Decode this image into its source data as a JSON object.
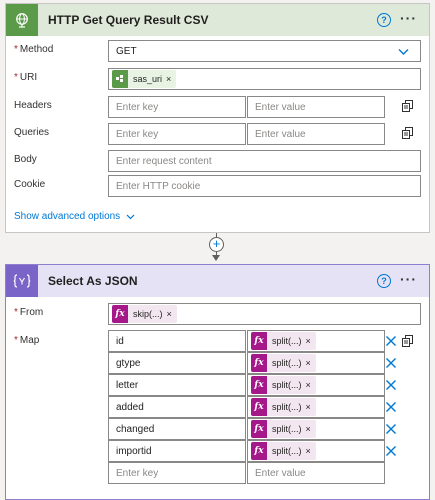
{
  "card1": {
    "title": "HTTP Get Query Result CSV",
    "help": "?",
    "more": "···",
    "method": {
      "label": "Method",
      "value": "GET"
    },
    "uri": {
      "label": "URI",
      "token": "sas_uri"
    },
    "headers": {
      "label": "Headers",
      "key_placeholder": "Enter key",
      "value_placeholder": "Enter value"
    },
    "queries": {
      "label": "Queries",
      "key_placeholder": "Enter key",
      "value_placeholder": "Enter value"
    },
    "body": {
      "label": "Body",
      "placeholder": "Enter request content"
    },
    "cookie": {
      "label": "Cookie",
      "placeholder": "Enter HTTP cookie"
    },
    "advanced": "Show advanced options"
  },
  "add_step": "+",
  "card2": {
    "title": "Select As JSON",
    "help": "?",
    "more": "···",
    "from": {
      "label": "From",
      "token": "skip(...)"
    },
    "map": {
      "label": "Map",
      "rows": [
        {
          "key": "id",
          "token": "split(...)"
        },
        {
          "key": "gtype",
          "token": "split(...)"
        },
        {
          "key": "letter",
          "token": "split(...)"
        },
        {
          "key": "added",
          "token": "split(...)"
        },
        {
          "key": "changed",
          "token": "split(...)"
        },
        {
          "key": "importid",
          "token": "split(...)"
        }
      ],
      "key_placeholder": "Enter key",
      "value_placeholder": "Enter value"
    }
  },
  "fx_glyph": "fx",
  "token_close": "×",
  "required_mark": "*",
  "colors": {
    "http_accent": "#5a9a49",
    "select_accent": "#7b64c8",
    "expression_token": "#a5188a",
    "link": "#0078d4"
  },
  "icons": [
    "globe-icon",
    "select-braces-icon",
    "help-icon",
    "more-icon",
    "chevron-down-icon",
    "copy-icon",
    "delete-x-icon",
    "fx-icon",
    "variable-icon"
  ]
}
